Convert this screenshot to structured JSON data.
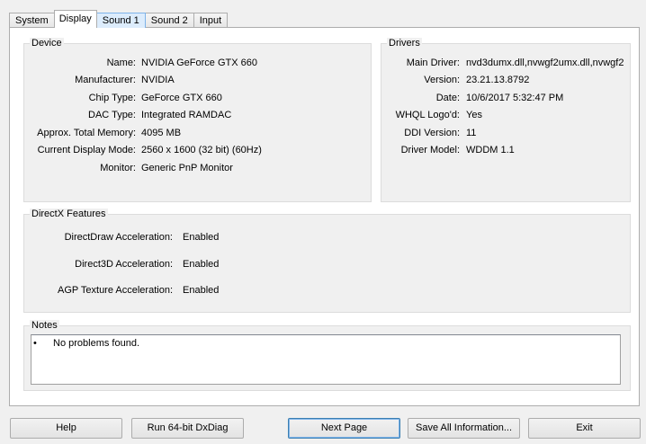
{
  "tabs": [
    {
      "label": "System"
    },
    {
      "label": "Display"
    },
    {
      "label": "Sound 1"
    },
    {
      "label": "Sound 2"
    },
    {
      "label": "Input"
    }
  ],
  "device": {
    "title": "Device",
    "rows": [
      {
        "label": "Name:",
        "value": "NVIDIA GeForce GTX 660"
      },
      {
        "label": "Manufacturer:",
        "value": "NVIDIA"
      },
      {
        "label": "Chip Type:",
        "value": "GeForce GTX 660"
      },
      {
        "label": "DAC Type:",
        "value": "Integrated RAMDAC"
      },
      {
        "label": "Approx. Total Memory:",
        "value": "4095 MB"
      },
      {
        "label": "Current Display Mode:",
        "value": "2560 x 1600 (32 bit) (60Hz)"
      },
      {
        "label": "Monitor:",
        "value": "Generic PnP Monitor"
      }
    ]
  },
  "drivers": {
    "title": "Drivers",
    "rows": [
      {
        "label": "Main Driver:",
        "value": "nvd3dumx.dll,nvwgf2umx.dll,nvwgf2"
      },
      {
        "label": "Version:",
        "value": "23.21.13.8792"
      },
      {
        "label": "Date:",
        "value": "10/6/2017 5:32:47 PM"
      },
      {
        "label": "WHQL Logo'd:",
        "value": "Yes"
      },
      {
        "label": "DDI Version:",
        "value": "11"
      },
      {
        "label": "Driver Model:",
        "value": "WDDM 1.1"
      }
    ]
  },
  "directx": {
    "title": "DirectX Features",
    "rows": [
      {
        "label": "DirectDraw Acceleration:",
        "value": "Enabled"
      },
      {
        "label": "Direct3D Acceleration:",
        "value": "Enabled"
      },
      {
        "label": "AGP Texture Acceleration:",
        "value": "Enabled"
      }
    ]
  },
  "notes": {
    "title": "Notes",
    "bullet": "•",
    "items": [
      "No problems found."
    ]
  },
  "buttons": {
    "help": "Help",
    "run64": "Run 64-bit DxDiag",
    "next": "Next Page",
    "save": "Save All Information...",
    "exit": "Exit"
  }
}
